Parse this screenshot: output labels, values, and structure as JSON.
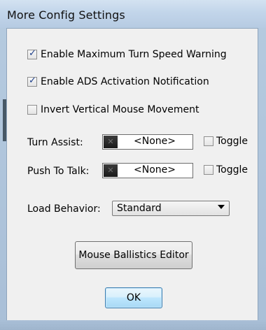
{
  "window": {
    "title": "More Config Settings"
  },
  "checkboxes": [
    {
      "label": "Enable Maximum Turn Speed Warning",
      "checked": true
    },
    {
      "label": "Enable ADS Activation Notification",
      "checked": true
    },
    {
      "label": "Invert Vertical Mouse Movement",
      "checked": false
    }
  ],
  "turn_assist": {
    "label": "Turn Assist:",
    "value": "<None>",
    "toggle_label": "Toggle",
    "toggle_checked": false
  },
  "push_to_talk": {
    "label": "Push To Talk:",
    "value": "<None>",
    "toggle_label": "Toggle",
    "toggle_checked": false
  },
  "load_behavior": {
    "label": "Load Behavior:",
    "selected": "Standard"
  },
  "buttons": {
    "ballistics": "Mouse Ballistics Editor",
    "ok": "OK"
  },
  "icons": {
    "key_clear": "x-icon",
    "dropdown": "chevron-down-icon"
  }
}
